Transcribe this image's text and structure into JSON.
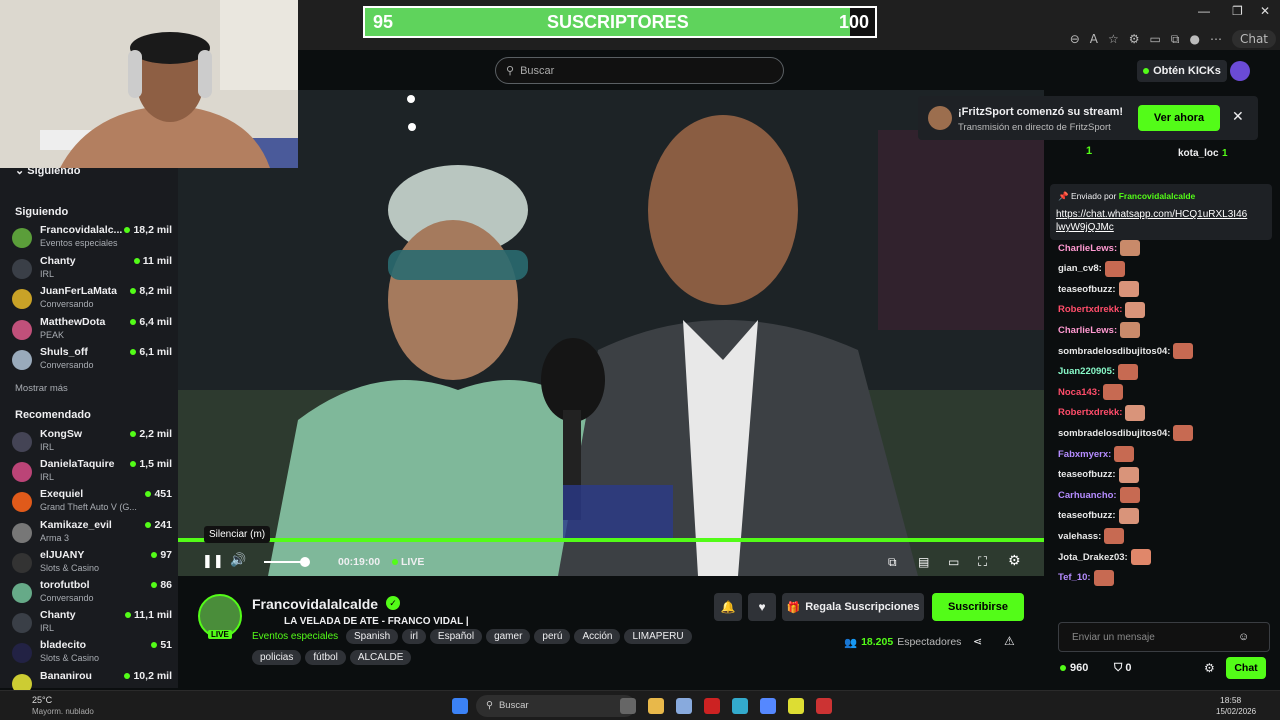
{
  "browser": {
    "window_controls": [
      "—",
      "❐",
      "✕"
    ],
    "chat_button": "Chat"
  },
  "overlay": {
    "subs_left": "95",
    "subs_label": "SUSCRIPTORES",
    "subs_right": "100",
    "subs_progress": 0.95
  },
  "topbar": {
    "search_placeholder": "Buscar",
    "get_kicks": "Obtén KICKs"
  },
  "sidebar": {
    "collapsed_header": "Siguiendo",
    "following_title": "Siguiendo",
    "following": [
      {
        "name": "Francovidalalc...",
        "category": "Eventos especiales",
        "viewers": "18,2 mil",
        "color": "#5b9e3a"
      },
      {
        "name": "Chanty",
        "category": "IRL",
        "viewers": "11 mil",
        "color": "#3a3f47"
      },
      {
        "name": "JuanFerLaMata",
        "category": "Conversando",
        "viewers": "8,2 mil",
        "color": "#c9a227"
      },
      {
        "name": "MatthewDota",
        "category": "PEAK",
        "viewers": "6,4 mil",
        "color": "#c0507a"
      },
      {
        "name": "Shuls_off",
        "category": "Conversando",
        "viewers": "6,1 mil",
        "color": "#9ab"
      }
    ],
    "show_more": "Mostrar más",
    "recommended_title": "Recomendado",
    "recommended": [
      {
        "name": "KongSw",
        "category": "IRL",
        "viewers": "2,2 mil",
        "color": "#445"
      },
      {
        "name": "DanielaTaquire",
        "category": "IRL",
        "viewers": "1,5 mil",
        "color": "#b47"
      },
      {
        "name": "Exequiel",
        "category": "Grand Theft Auto V (G...",
        "viewers": "451",
        "color": "#e05a1a"
      },
      {
        "name": "Kamikaze_evil",
        "category": "Arma 3",
        "viewers": "241",
        "color": "#777"
      },
      {
        "name": "elJUANY",
        "category": "Slots & Casino",
        "viewers": "97",
        "color": "#333"
      },
      {
        "name": "torofutbol",
        "category": "Conversando",
        "viewers": "86",
        "color": "#6a8"
      },
      {
        "name": "Chanty",
        "category": "IRL",
        "viewers": "11,1 mil",
        "color": "#3a3f47"
      },
      {
        "name": "bladecito",
        "category": "Slots & Casino",
        "viewers": "51",
        "color": "#224"
      },
      {
        "name": "Bananirou",
        "category": "",
        "viewers": "10,2 mil",
        "color": "#cc3"
      }
    ]
  },
  "player": {
    "tooltip": "Silenciar (m)",
    "time": "00:19:00",
    "live": "LIVE",
    "volume": 0.6
  },
  "stream": {
    "channel": "Francovidalalcalde",
    "title": "LA VELADA DE ATE - FRANCO VIDAL |",
    "category": "Eventos especiales",
    "tags": [
      "Spanish",
      "irl",
      "Español",
      "gamer",
      "perú",
      "Acción",
      "LIMAPERU",
      "policias",
      "fútbol",
      "ALCALDE"
    ],
    "live_badge": "LIVE",
    "gift_button": "Regala Suscripciones",
    "subscribe_button": "Suscribirse",
    "viewers": "18.205",
    "viewers_label": "Espectadores"
  },
  "notification": {
    "title": "¡FritzSport comenzó su stream!",
    "subtitle": "Transmisión en directo de FritzSport",
    "button": "Ver ahora"
  },
  "chat": {
    "top_counts": [
      "1",
      "1"
    ],
    "top_user": "kota_loc",
    "pinned_by_label": "Enviado por",
    "pinned_by": "Francovidalalcalde",
    "pinned_link": "https://chat.whatsapp.com/HCQ1uRXL3I46lwyW9jQJMc",
    "messages": [
      {
        "user": "CharlieLews:",
        "color": "#ff9ad1",
        "emote": "#c98a6a"
      },
      {
        "user": "gian_cv8:",
        "color": "#e8e8e8",
        "emote": "#c76a52"
      },
      {
        "user": "teaseofbuzz:",
        "color": "#e8e8e8",
        "emote": "#d9947a"
      },
      {
        "user": "Robertxdrekk:",
        "color": "#ff4d6a",
        "emote": "#d9947a"
      },
      {
        "user": "CharlieLews:",
        "color": "#ff9ad1",
        "emote": "#c98a6a"
      },
      {
        "user": "sombradelosdibujitos04:",
        "color": "#e8e8e8",
        "emote": "#c76a52"
      },
      {
        "user": "Juan220905:",
        "color": "#88f8c8",
        "emote": "#c76a52"
      },
      {
        "user": "Noca143:",
        "color": "#ff4d6a",
        "emote": "#c76a52"
      },
      {
        "user": "Robertxdrekk:",
        "color": "#ff4d6a",
        "emote": "#d9947a"
      },
      {
        "user": "sombradelosdibujitos04:",
        "color": "#e8e8e8",
        "emote": "#c76a52"
      },
      {
        "user": "Fabxmyerx:",
        "color": "#b58cff",
        "emote": "#c76a52"
      },
      {
        "user": "teaseofbuzz:",
        "color": "#e8e8e8",
        "emote": "#d9947a"
      },
      {
        "user": "Carhuancho:",
        "color": "#b58cff",
        "emote": "#c76a52"
      },
      {
        "user": "teaseofbuzz:",
        "color": "#e8e8e8",
        "emote": "#d9947a"
      },
      {
        "user": "valehass:",
        "color": "#e8e8e8",
        "emote": "#c76a52"
      },
      {
        "user": "Jota_Drakez03:",
        "color": "#e8e8e8",
        "emote": "#e0876a"
      },
      {
        "user": "Tef_10:",
        "color": "#b58cff",
        "emote": "#c76a52"
      }
    ],
    "input_placeholder": "Enviar un mensaje",
    "kicks_count": "960",
    "points": "0",
    "send_button": "Chat"
  },
  "taskbar": {
    "temp": "25°C",
    "weather": "Mayorm. nublado",
    "search": "Buscar",
    "time": "18:58",
    "date": "15/02/2026"
  },
  "colors": {
    "kick_green": "#53fc18",
    "bg": "#0b0e0f",
    "sidebar": "#191b1f"
  }
}
